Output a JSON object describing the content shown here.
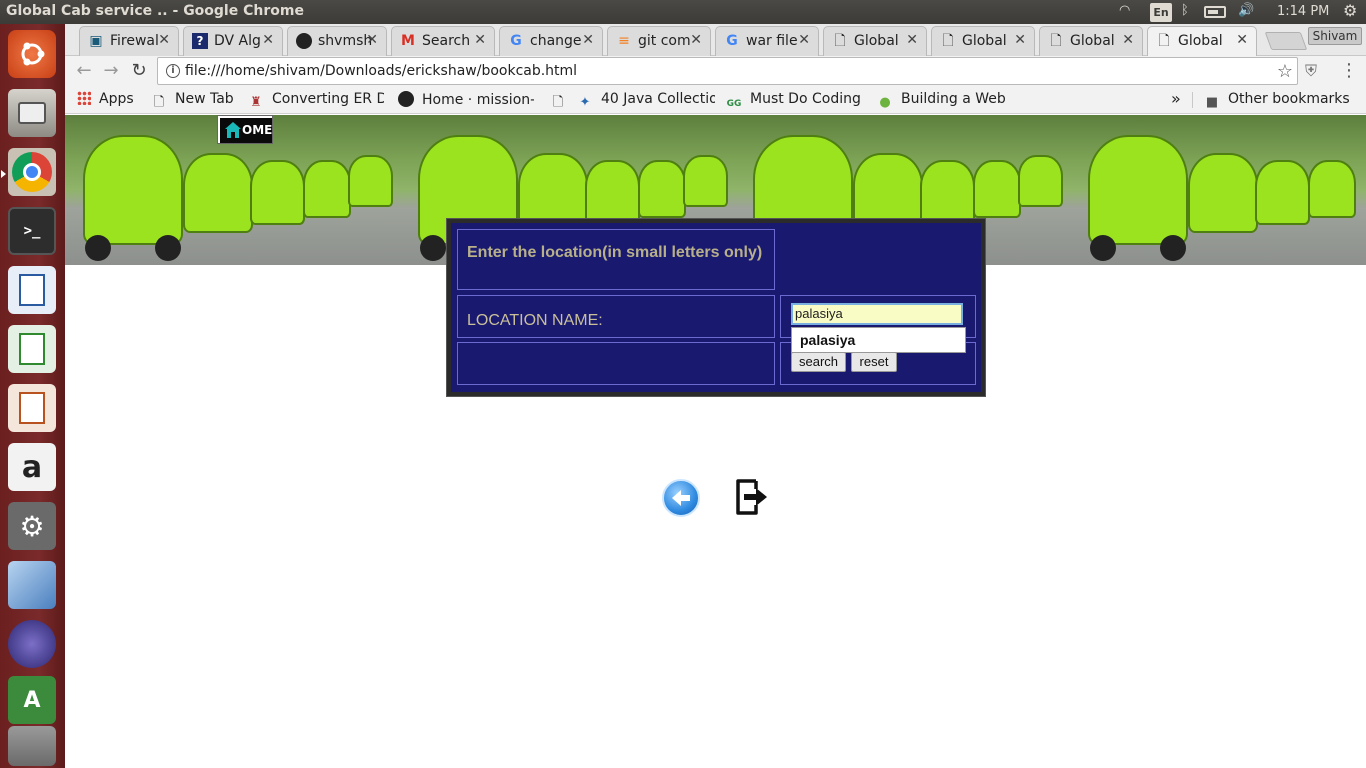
{
  "window": {
    "title": "Global Cab service .. - Google Chrome"
  },
  "tray": {
    "lang": "En",
    "clock": "1:14 PM"
  },
  "browser": {
    "profile": "Shivam",
    "tabs": [
      {
        "label": "Firewal",
        "icon": "bookmark-icon"
      },
      {
        "label": "DV Alg",
        "icon": "question-icon"
      },
      {
        "label": "shvmsh",
        "icon": "github-icon"
      },
      {
        "label": "Search",
        "icon": "gmail-icon"
      },
      {
        "label": "change",
        "icon": "google-icon"
      },
      {
        "label": "git com",
        "icon": "stackoverflow-icon"
      },
      {
        "label": "war file",
        "icon": "google-icon"
      },
      {
        "label": "Global",
        "icon": "page-icon"
      },
      {
        "label": "Global",
        "icon": "page-icon"
      },
      {
        "label": "Global",
        "icon": "page-icon"
      },
      {
        "label": "Global",
        "icon": "page-icon"
      }
    ],
    "url": "file:///home/shivam/Downloads/erickshaw/bookcab.html",
    "bookmarks": [
      {
        "label": "Apps"
      },
      {
        "label": "New Tab"
      },
      {
        "label": "Converting ER D"
      },
      {
        "label": "Home · mission-"
      },
      {
        "label": ""
      },
      {
        "label": "40 Java Collectio"
      },
      {
        "label": "Must Do Coding"
      },
      {
        "label": "Building a Web"
      }
    ],
    "overflow": "»",
    "other_bookmarks": "Other bookmarks"
  },
  "page": {
    "home_badge": "OME",
    "form": {
      "prompt": "Enter the location(in small letters only)",
      "location_label": "LOCATION NAME:",
      "location_value": "palasiya",
      "autocomplete_suggestion": "palasiya",
      "search_label": "search",
      "reset_label": "reset"
    }
  }
}
